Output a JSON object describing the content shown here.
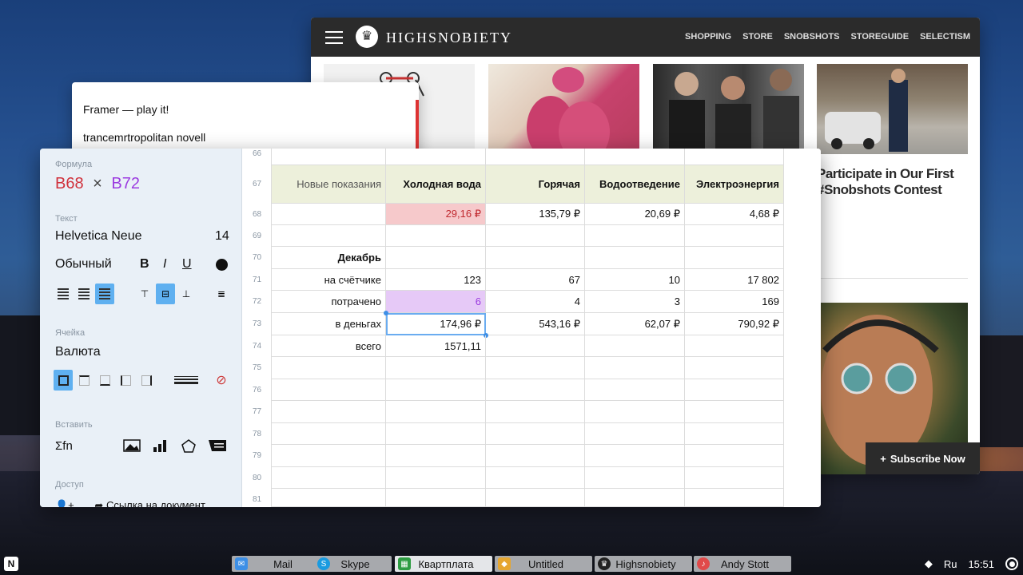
{
  "highsnobiety": {
    "brand": "HIGHSNOBIETY",
    "nav": [
      "SHOPPING",
      "STORE",
      "SNOBSHOTS",
      "STOREGUIDE",
      "SELECTISM"
    ],
    "article_title": "Participate in Our First #Snobshots Contest",
    "subscribe_label": "Subscribe Now"
  },
  "notes": {
    "lines": [
      "Framer — play it!",
      "trancemrtropolitan novell"
    ]
  },
  "sidebar": {
    "formula_label": "Формула",
    "formula_ref1": "B68",
    "formula_op": "×",
    "formula_ref2": "B72",
    "text_label": "Текст",
    "font_name": "Helvetica Neue",
    "font_size": "14",
    "style_name": "Обычный",
    "bold": "B",
    "italic": "I",
    "underline": "U",
    "cell_label": "Ячейка",
    "cell_type": "Валюта",
    "insert_label": "Вставить",
    "insert_formula": "Σfn",
    "access_label": "Доступ",
    "access_link": "Ссылка на документ"
  },
  "grid": {
    "rows": [
      "66",
      "67",
      "68",
      "69",
      "70",
      "71",
      "72",
      "73",
      "74",
      "75",
      "76",
      "77",
      "78",
      "79",
      "80",
      "81"
    ],
    "header": [
      "Новые показания",
      "Холодная вода",
      "Горячая",
      "Водоотведение",
      "Электроэнергия"
    ],
    "r68": [
      "",
      "29,16 ₽",
      "135,79 ₽",
      "20,69 ₽",
      "4,68 ₽"
    ],
    "r70": [
      "Декабрь",
      "",
      "",
      "",
      ""
    ],
    "r71": [
      "на счётчике",
      "123",
      "67",
      "10",
      "17 802"
    ],
    "r72": [
      "потрачено",
      "6",
      "4",
      "3",
      "169"
    ],
    "r73": [
      "в деньгах",
      "174,96 ₽",
      "543,16 ₽",
      "62,07 ₽",
      "790,92 ₽"
    ],
    "r74": [
      "всего",
      "1571,11",
      "",
      "",
      ""
    ]
  },
  "taskbar": {
    "logo": "N",
    "tasks": [
      "Mail",
      "Skype",
      "Квартплата",
      "Untitled",
      "Highsnobiety",
      "Andy Stott"
    ],
    "lang": "Ru",
    "time": "15:51"
  },
  "colors": {
    "formula_ref1": "#d0313c",
    "formula_ref2": "#9b3be0",
    "selection": "#5fb0f0",
    "header_bg": "#edf0db"
  }
}
